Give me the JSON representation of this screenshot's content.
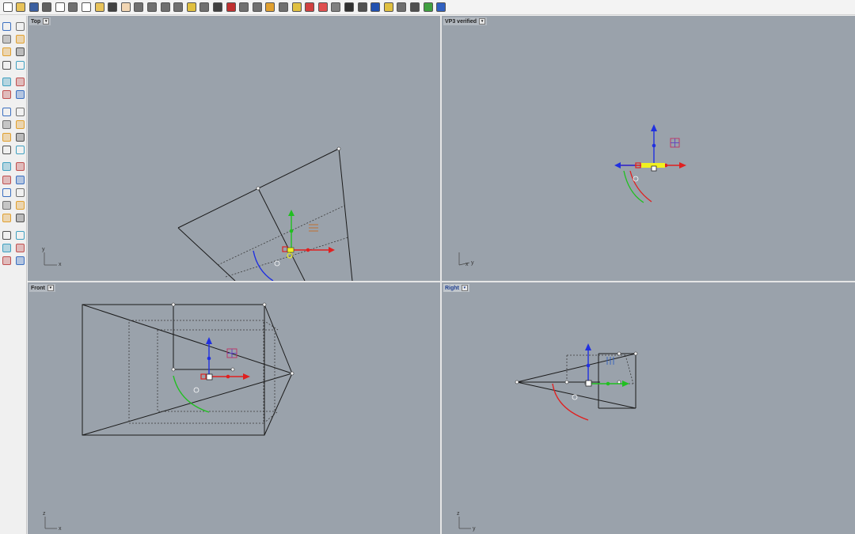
{
  "toolbar": {
    "buttons": [
      {
        "name": "new-icon",
        "color": "#ffffff"
      },
      {
        "name": "open-icon",
        "color": "#e8c35a"
      },
      {
        "name": "save-icon",
        "color": "#3b5fa0"
      },
      {
        "name": "print-icon",
        "color": "#606060"
      },
      {
        "name": "import-icon",
        "color": "#ffffff"
      },
      {
        "name": "cut-icon",
        "color": "#707070"
      },
      {
        "name": "copy-icon",
        "color": "#ffffff"
      },
      {
        "name": "paste-icon",
        "color": "#e8c35a"
      },
      {
        "name": "undo-icon",
        "color": "#404040"
      },
      {
        "name": "pan-icon",
        "color": "#f2d6b3"
      },
      {
        "name": "rotate-view-icon",
        "color": "#707070"
      },
      {
        "name": "zoom-icon",
        "color": "#707070"
      },
      {
        "name": "zoom-window-icon",
        "color": "#707070"
      },
      {
        "name": "zoom-extents-icon",
        "color": "#707070"
      },
      {
        "name": "zoom-selected-icon",
        "color": "#e0c040"
      },
      {
        "name": "zoom-target-icon",
        "color": "#707070"
      },
      {
        "name": "four-viewports-icon",
        "color": "#404040"
      },
      {
        "name": "named-view-icon",
        "color": "#c03030"
      },
      {
        "name": "named-cplane-icon",
        "color": "#707070"
      },
      {
        "name": "undo-view-icon",
        "color": "#707070"
      },
      {
        "name": "select-all-icon",
        "color": "#e0a030"
      },
      {
        "name": "hide-icon",
        "color": "#707070"
      },
      {
        "name": "lock-icon",
        "color": "#e0c040"
      },
      {
        "name": "layer-icon",
        "color": "#d04040"
      },
      {
        "name": "properties-icon",
        "color": "#e05050"
      },
      {
        "name": "wireframe-icon",
        "color": "#808080"
      },
      {
        "name": "shaded-icon",
        "color": "#303030"
      },
      {
        "name": "rendered-icon",
        "color": "#505050"
      },
      {
        "name": "render-icon",
        "color": "#2050b0"
      },
      {
        "name": "light-icon",
        "color": "#e0c040"
      },
      {
        "name": "settings-icon",
        "color": "#707070"
      },
      {
        "name": "grasshopper-icon",
        "color": "#505050"
      },
      {
        "name": "plugin-icon",
        "color": "#40a040"
      },
      {
        "name": "help-icon",
        "color": "#3060c0"
      }
    ]
  },
  "sidebar": {
    "rows": [
      [
        "select-icon",
        "point-icon"
      ],
      [
        "polyline-icon",
        "curve-icon"
      ],
      [
        "circle-icon",
        "ellipse-icon"
      ],
      [
        "arc-icon",
        "rectangle-icon"
      ],
      [
        "polygon-icon",
        "fillet-icon"
      ],
      [
        "freeform-icon",
        "offset-icon"
      ],
      [
        "box-icon",
        "sphere-icon"
      ],
      [
        "cylinder-icon",
        "extrude-icon"
      ],
      [
        "boolean-union-icon",
        "explode-icon"
      ],
      [
        "trim-icon",
        "split-icon"
      ],
      [
        "group-icon",
        "join-icon"
      ],
      [
        "blend-icon",
        "rebuild-icon"
      ],
      [
        "move-icon",
        "scale-icon"
      ],
      [
        "array-icon",
        "mirror-icon"
      ],
      [
        "solid-icon",
        "dimension-icon"
      ],
      [
        "grid-icon",
        "transform-icon"
      ],
      [
        "analyze-icon",
        "check-icon"
      ],
      [
        "render-tools-icon",
        "drafting-icon"
      ]
    ]
  },
  "viewports": {
    "top": {
      "title": "Top",
      "axis_x": "x",
      "axis_y": "y"
    },
    "vp3": {
      "title": "VP3 verified",
      "axis_x": "x",
      "axis_y": "y"
    },
    "front": {
      "title": "Front",
      "axis_x": "x",
      "axis_y": "z"
    },
    "right": {
      "title": "Right",
      "axis_x": "y",
      "axis_y": "z"
    }
  },
  "colors": {
    "viewport_bg": "#9aa2ab",
    "wire": "#1a1a1a",
    "gumball_x": "#e02020",
    "gumball_y": "#20c020",
    "gumball_z": "#2030e0",
    "selected": "#f0f020"
  }
}
